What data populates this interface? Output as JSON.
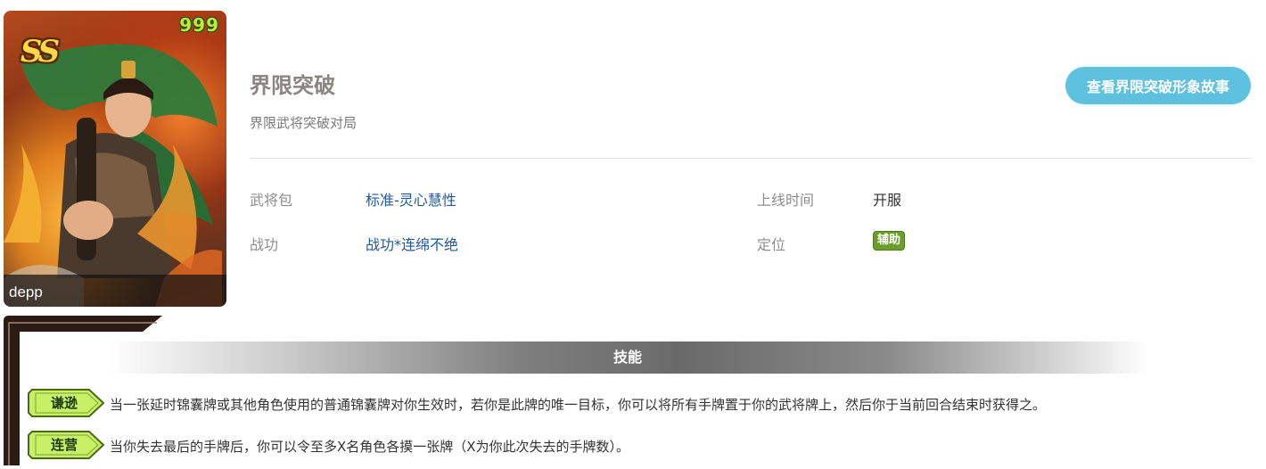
{
  "portrait": {
    "tier": "SS",
    "level": "999",
    "name": "depp"
  },
  "hero": {
    "title": "界限突破",
    "subtitle": "界限武将突破对局",
    "story_button": "查看界限突破形象故事"
  },
  "info": {
    "pack_label": "武将包",
    "pack_value": "标准-灵心慧性",
    "release_label": "上线时间",
    "release_value": "开服",
    "merit_label": "战功",
    "merit_value": "战功*连绵不绝",
    "role_label": "定位",
    "role_value": "辅助"
  },
  "skills": {
    "header": "技能",
    "items": [
      {
        "name": "谦逊",
        "description": "当一张延时锦囊牌或其他角色使用的普通锦囊牌对你生效时，若你是此牌的唯一目标，你可以将所有手牌置于你的武将牌上，然后你于当前回合结束时获得之。"
      },
      {
        "name": "连营",
        "description": "当你失去最后的手牌后，你可以令至多X名角色各摸一张牌（X为你此次失去的手牌数）。"
      }
    ]
  },
  "colors": {
    "accent_button": "#5ec1df",
    "link": "#20589c",
    "role_tag": "#6c9e2b",
    "skill_badge": "#c9ef66"
  }
}
